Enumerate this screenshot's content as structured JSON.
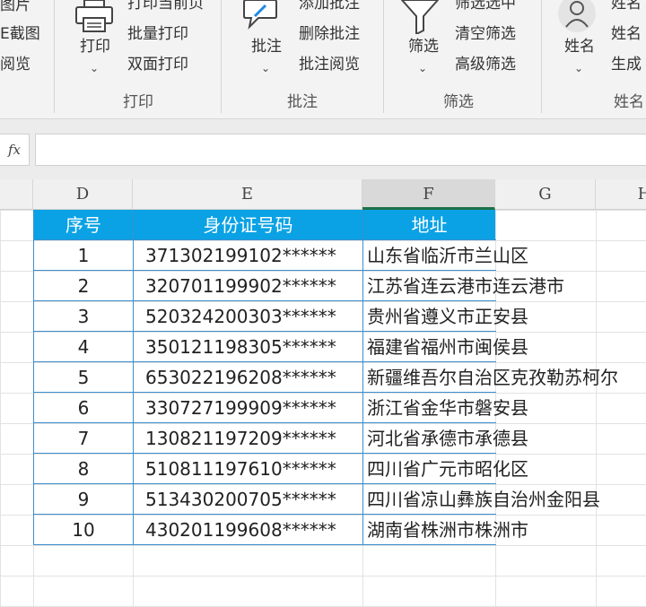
{
  "ribbon": {
    "left_partial": [
      "图片",
      "E截图",
      "阅览"
    ],
    "print_preview": "打印当前页",
    "print_button": "打印",
    "batch_print": "批量打印",
    "duplex_print": "双面打印",
    "print_group": "打印",
    "comment_button": "批注",
    "add_comment": "添加批注",
    "delete_comment": "删除批注",
    "review_comment": "批注阅览",
    "comment_group": "批注",
    "filter_button": "筛选",
    "filter_selected": "筛选选中",
    "clear_filter": "清空筛选",
    "advanced_filter": "高级筛选",
    "filter_group": "筛选",
    "name_button": "姓名",
    "name_partial_1": "姓名",
    "name_partial_2": "姓名",
    "name_partial_3": "生成",
    "name_group": "姓名"
  },
  "formula_bar": {
    "fx_label": "fx",
    "value": ""
  },
  "columns": [
    "D",
    "E",
    "F",
    "G",
    "H"
  ],
  "table": {
    "headers": [
      "序号",
      "身份证号码",
      "地址"
    ],
    "rows": [
      [
        "1",
        "371302199102******",
        "山东省临沂市兰山区"
      ],
      [
        "2",
        "320701199902******",
        "江苏省连云港市连云港市"
      ],
      [
        "3",
        "520324200303******",
        "贵州省遵义市正安县"
      ],
      [
        "4",
        "350121198305******",
        "福建省福州市闽侯县"
      ],
      [
        "5",
        "653022196208******",
        "新疆维吾尔自治区克孜勒苏柯尔"
      ],
      [
        "6",
        "330727199909******",
        "浙江省金华市磐安县"
      ],
      [
        "7",
        "130821197209******",
        "河北省承德市承德县"
      ],
      [
        "8",
        "510811197610******",
        "四川省广元市昭化区"
      ],
      [
        "9",
        "513430200705******",
        "四川省凉山彝族自治州金阳县"
      ],
      [
        "10",
        "430201199608******",
        "湖南省株洲市株洲市"
      ]
    ]
  },
  "colors": {
    "header_fill": "#0aa2e5",
    "table_border": "#3b8fcf",
    "selected_col_underline": "#1e7145"
  }
}
